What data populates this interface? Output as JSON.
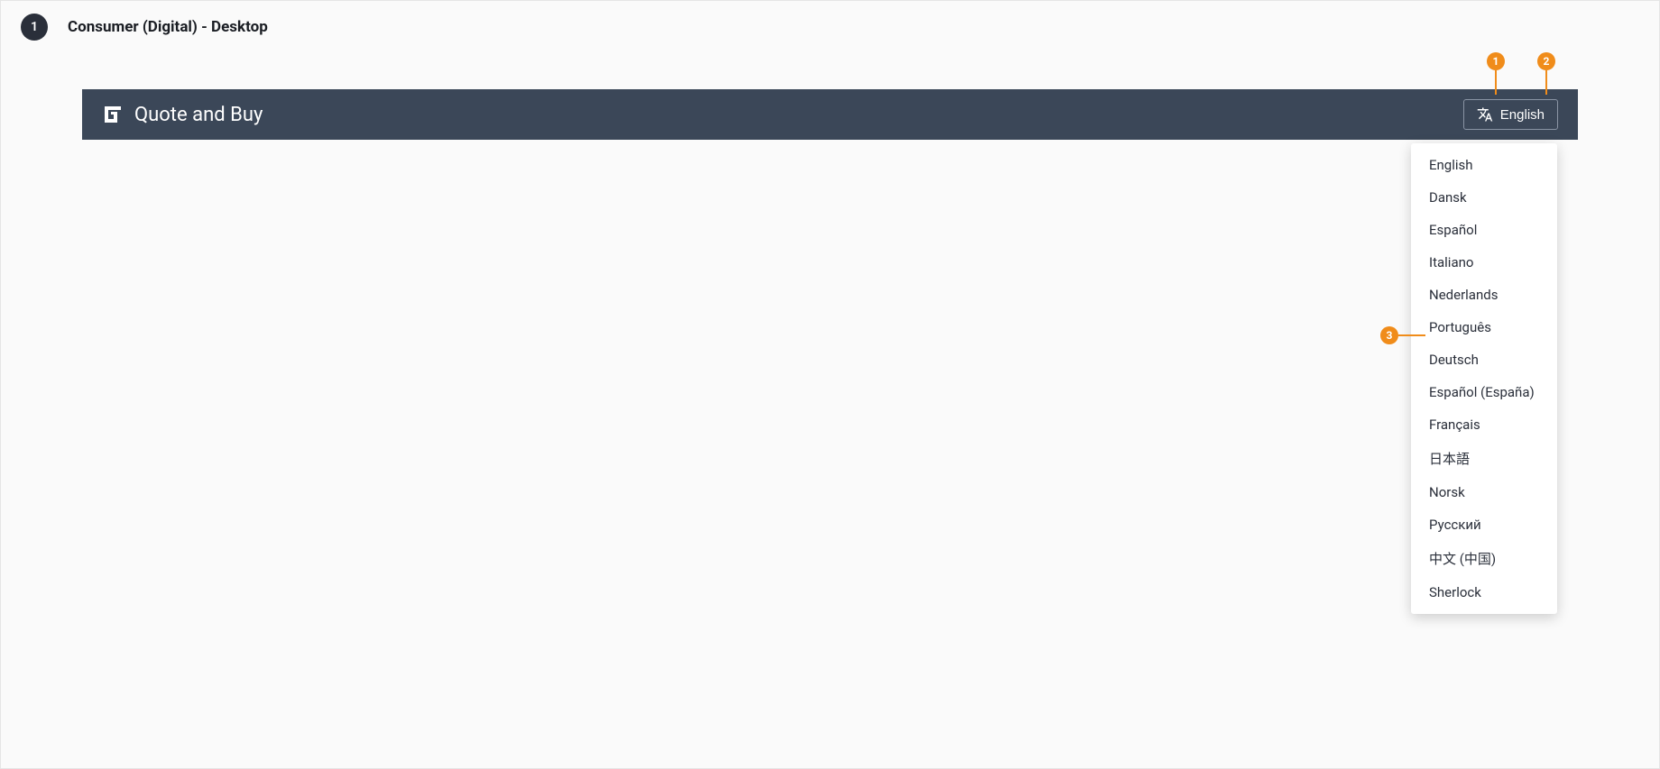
{
  "header": {
    "step_number": "1",
    "title": "Consumer (Digital) - Desktop"
  },
  "app": {
    "brand_text": "Quote and Buy",
    "language_button_label": "English",
    "language_options": [
      "English",
      "Dansk",
      "Español",
      "Italiano",
      "Nederlands",
      "Português",
      "Deutsch",
      "Español (España)",
      "Français",
      "日本語",
      "Norsk",
      "Русский",
      "中文 (中国)",
      "Sherlock"
    ]
  },
  "annotations": {
    "a1": "1",
    "a2": "2",
    "a3": "3"
  }
}
